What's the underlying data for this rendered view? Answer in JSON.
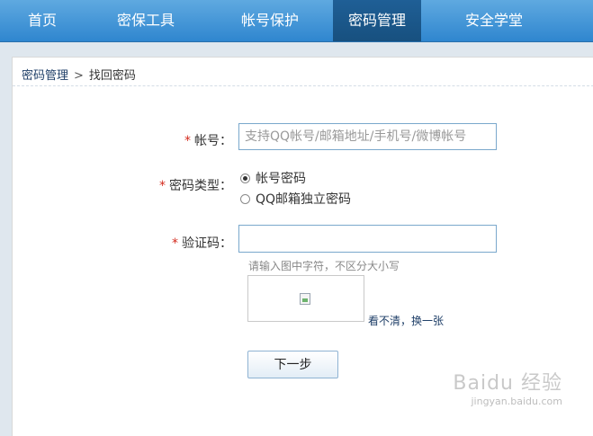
{
  "nav": {
    "items": [
      {
        "label": "首页"
      },
      {
        "label": "密保工具"
      },
      {
        "label": "帐号保护"
      },
      {
        "label": "密码管理"
      },
      {
        "label": "安全学堂"
      }
    ],
    "active_index": 3
  },
  "breadcrumb": {
    "parent": "密码管理",
    "separator": ">",
    "current": "找回密码"
  },
  "form": {
    "required_mark": "*",
    "account_label": "帐号：",
    "account_placeholder": "支持QQ帐号/邮箱地址/手机号/微博帐号",
    "account_value": "",
    "password_type_label": "密码类型：",
    "password_type_options": [
      "帐号密码",
      "QQ邮箱独立密码"
    ],
    "password_type_selected": "帐号密码",
    "captcha_label": "验证码：",
    "captcha_value": "",
    "captcha_hint": "请输入图中字符，不区分大小写",
    "captcha_refresh": "看不清，换一张",
    "next_button": "下一步"
  },
  "watermark": {
    "logo": "Baidu 经验",
    "url": "jingyan.baidu.com"
  },
  "colors": {
    "nav_gradient_top": "#5fa9e0",
    "nav_active": "#1f5f96",
    "required": "#d42b1e",
    "link": "#1f3f68"
  }
}
